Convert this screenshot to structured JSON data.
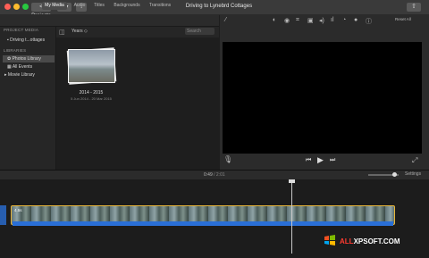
{
  "window": {
    "projects_label": "< Projects",
    "title": "Driving to Lynebrd Cottages",
    "down_label": "↓",
    "share_label": "⇧"
  },
  "tabs": [
    "My Media",
    "Audio",
    "Titles",
    "Backgrounds",
    "Transitions"
  ],
  "sidebar": {
    "project_media_head": "PROJECT MEDIA",
    "project_item": "Driving t...ottages",
    "libraries_head": "LIBRARIES",
    "photos_library": "Photos Library",
    "all_events": "All Events",
    "movie_library": "Movie Library"
  },
  "browser": {
    "filter": "Years ◇",
    "search_placeholder": "Search",
    "item_title": "2014 - 2015",
    "item_dates": "5 Jun 2014 - 20 Mar 2015"
  },
  "viewer_toolbar": {
    "reset_all": "Reset All"
  },
  "timeline": {
    "current_time": "0:49",
    "total_time": " / 2:01",
    "settings_label": "Settings",
    "clip_label": "4.5s",
    "zoom_level": 0.85
  },
  "watermark": {
    "text_red": "ALL",
    "text_white": "XPSOFT.COM"
  },
  "colors": {
    "clip_border": "#e8b63a",
    "audio": "#2a6fd6"
  }
}
